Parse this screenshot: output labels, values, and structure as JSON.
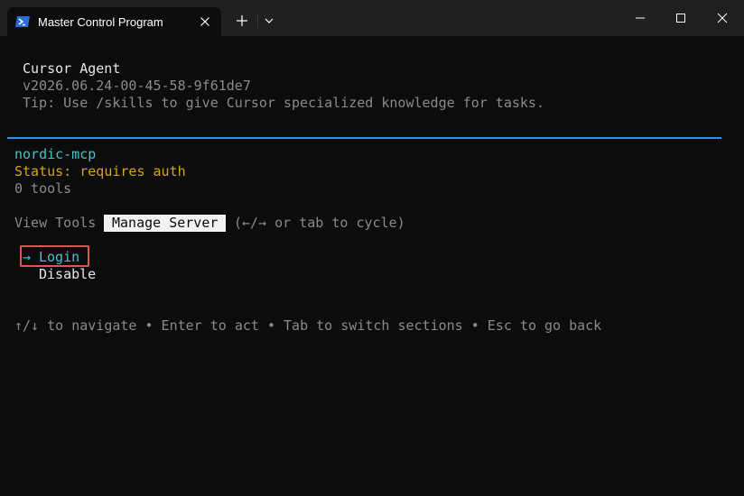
{
  "window": {
    "tab_title": "Master Control Program",
    "new_tab_glyph": "+",
    "icons": [
      "powershell-icon",
      "close-icon",
      "plus-icon",
      "chevron-down-icon",
      "minimize-icon",
      "maximize-icon",
      "close-icon"
    ]
  },
  "banner": {
    "app_name": "Cursor Agent",
    "version": "v2026.06.24-00-45-58-9f61de7",
    "tip": "Tip: Use /skills to give Cursor specialized knowledge for tasks."
  },
  "server": {
    "name": "nordic-mcp",
    "status": "Status: requires auth",
    "tools_count": "0 tools"
  },
  "tabs": {
    "view_tools": "View Tools",
    "manage_server": "Manage Server",
    "cycle_hint": "(←/→ or tab to cycle)"
  },
  "actions": {
    "arrow": "→",
    "login": "Login",
    "disable": "Disable"
  },
  "help_text": "↑/↓ to navigate • Enter to act • Tab to switch sections • Esc to go back",
  "colors": {
    "background": "#0c0c0c",
    "titlebar": "#202020",
    "divider": "#3b8ee0",
    "cyan": "#45c3c8",
    "yellow": "#d4a51c",
    "highlight_border": "#e35353"
  }
}
